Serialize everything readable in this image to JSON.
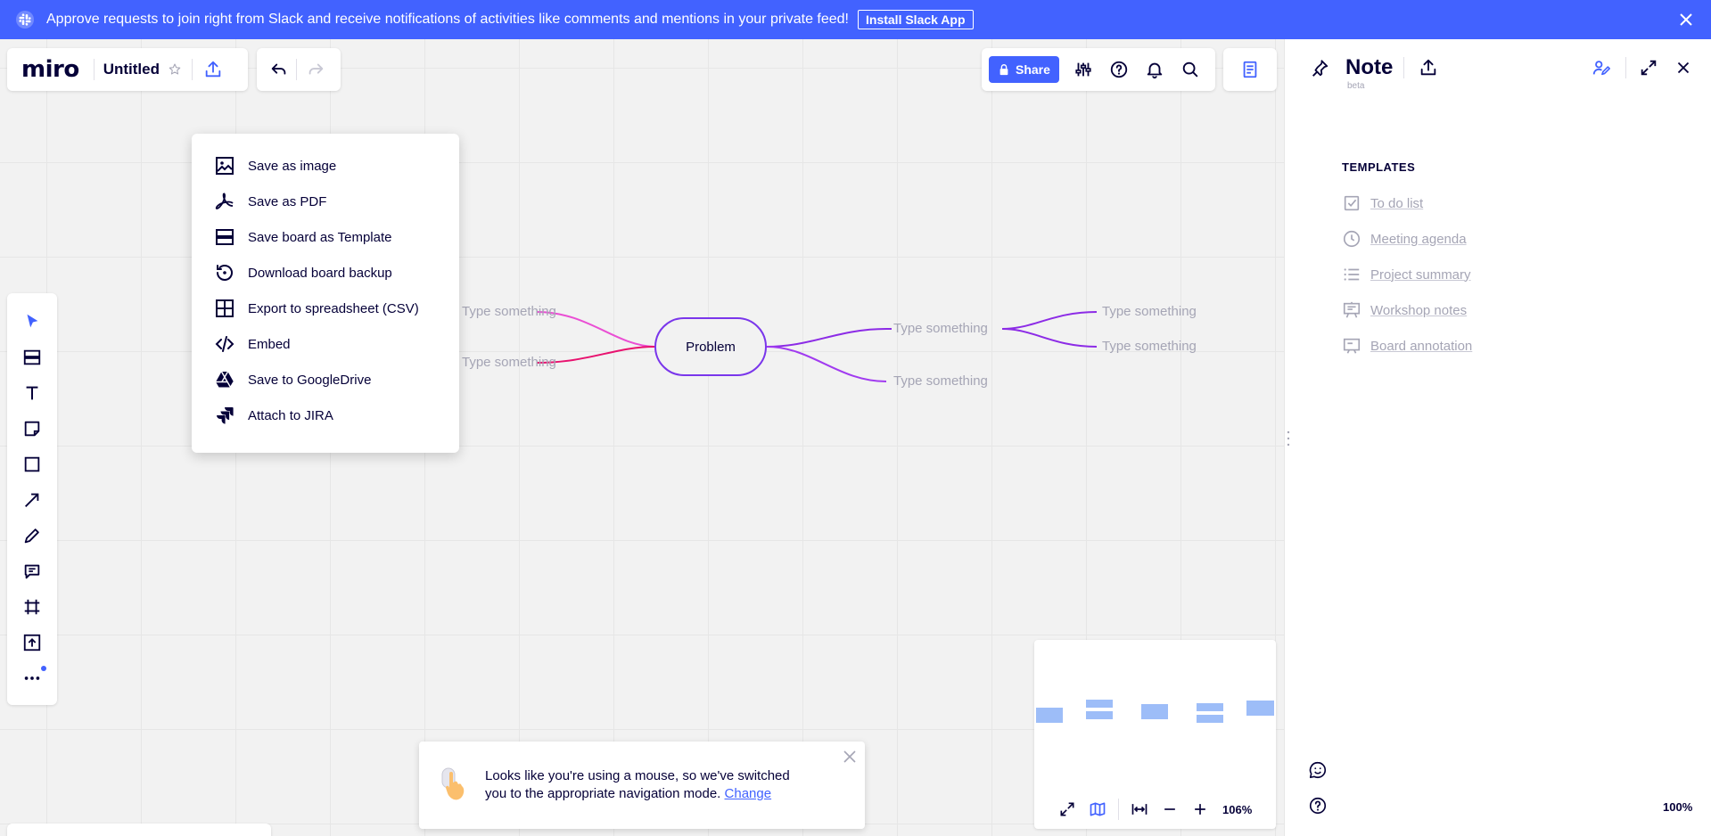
{
  "banner": {
    "message": "Approve requests to join right from Slack and receive notifications of activities like comments and mentions in your private feed!",
    "install_label": "Install Slack App",
    "icon": "slack-icon",
    "color": "#4262ff"
  },
  "board": {
    "logo": "miro",
    "title": "Untitled"
  },
  "toolbar": {
    "share_label": "Share"
  },
  "export_menu": {
    "items": [
      {
        "label": "Save as image",
        "icon": "image-icon"
      },
      {
        "label": "Save as PDF",
        "icon": "pdf-icon"
      },
      {
        "label": "Save board as Template",
        "icon": "template-icon"
      },
      {
        "label": "Download board backup",
        "icon": "backup-icon"
      },
      {
        "label": "Export to spreadsheet (CSV)",
        "icon": "spreadsheet-icon"
      },
      {
        "label": "Embed",
        "icon": "embed-icon"
      },
      {
        "label": "Save to GoogleDrive",
        "icon": "google-drive-icon"
      },
      {
        "label": "Attach to JIRA",
        "icon": "jira-icon"
      }
    ]
  },
  "mindmap": {
    "root": "Problem",
    "left_nodes": [
      "Type something",
      "Type something"
    ],
    "right_nodes": [
      "Type something",
      "Type something"
    ],
    "right_children": [
      "Type something",
      "Type something"
    ]
  },
  "toast": {
    "message": "Looks like you're using a mouse, so we've switched you to the appropriate navigation mode.",
    "link": "Change"
  },
  "minimap": {
    "zoom": "106%"
  },
  "notes_panel": {
    "title": "Note",
    "beta": "beta",
    "templates_label": "TEMPLATES",
    "templates": [
      {
        "label": "To do list",
        "icon": "checkbox-icon"
      },
      {
        "label": "Meeting agenda",
        "icon": "clock-icon"
      },
      {
        "label": "Project summary",
        "icon": "list-icon"
      },
      {
        "label": "Workshop notes",
        "icon": "easel-icon"
      },
      {
        "label": "Board annotation",
        "icon": "board-icon"
      }
    ],
    "page_zoom": "100%"
  },
  "colors": {
    "accent": "#4262ff",
    "mindmap_pink": "#ea4fd4",
    "mindmap_red": "#e8126f",
    "mindmap_purple": "#8c2be6",
    "minimap_shape": "#9dbdf8"
  }
}
